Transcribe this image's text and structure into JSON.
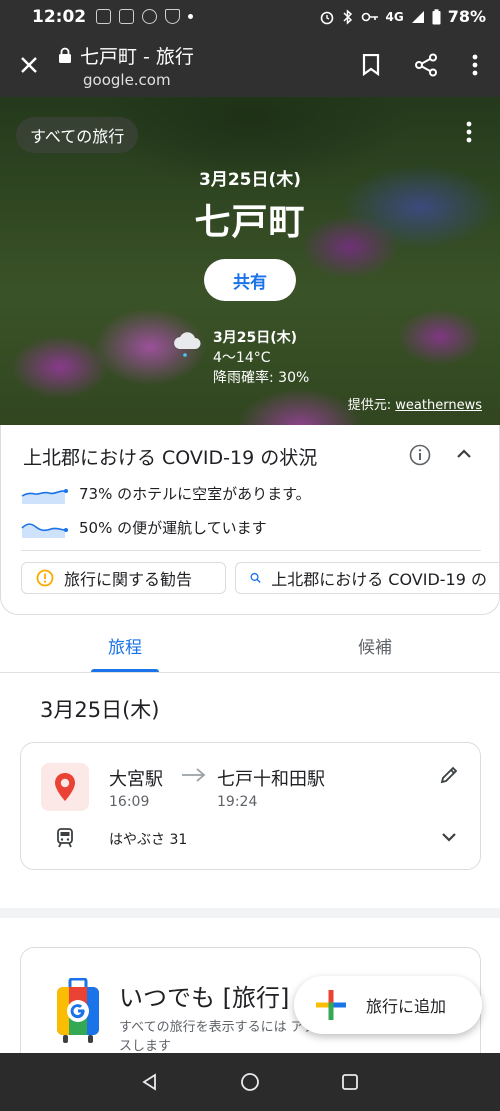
{
  "status_bar": {
    "time": "12:02",
    "network": "4G",
    "battery": "78%"
  },
  "app_bar": {
    "title": "七戸町 - 旅行",
    "url": "google.com"
  },
  "hero": {
    "back_chip": "すべての旅行",
    "date": "3月25日(木)",
    "title": "七戸町",
    "share_label": "共有",
    "weather": {
      "date": "3月25日(木)",
      "temp": "4〜14°C",
      "rain": "降雨確率: 30%"
    },
    "credit_prefix": "提供元: ",
    "credit_link": "weathernews"
  },
  "covid": {
    "title": "上北郡における COVID-19 の状況",
    "stat_hotels": "73% のホテルに空室があります。",
    "stat_flights": "50% の便が運航しています",
    "chip_advisory": "旅行に関する勧告",
    "chip_search": "上北郡における COVID-19 の"
  },
  "tabs": {
    "itinerary": "旅程",
    "candidates": "候補"
  },
  "day": {
    "header": "3月25日(木)"
  },
  "trip": {
    "from_station": "大宮駅",
    "from_time": "16:09",
    "to_station": "七戸十和田駅",
    "to_time": "19:24",
    "train_name": "はやぶさ 31"
  },
  "promo": {
    "title": "いつでも [旅行] に",
    "desc": "すべての旅行を表示するには アクセスします"
  },
  "fab": {
    "label": "旅行に追加"
  },
  "colors": {
    "accent": "#1a73e8",
    "pin": "#ea4335",
    "pin_bg": "#fce8e6",
    "dark_bar": "#303030"
  }
}
